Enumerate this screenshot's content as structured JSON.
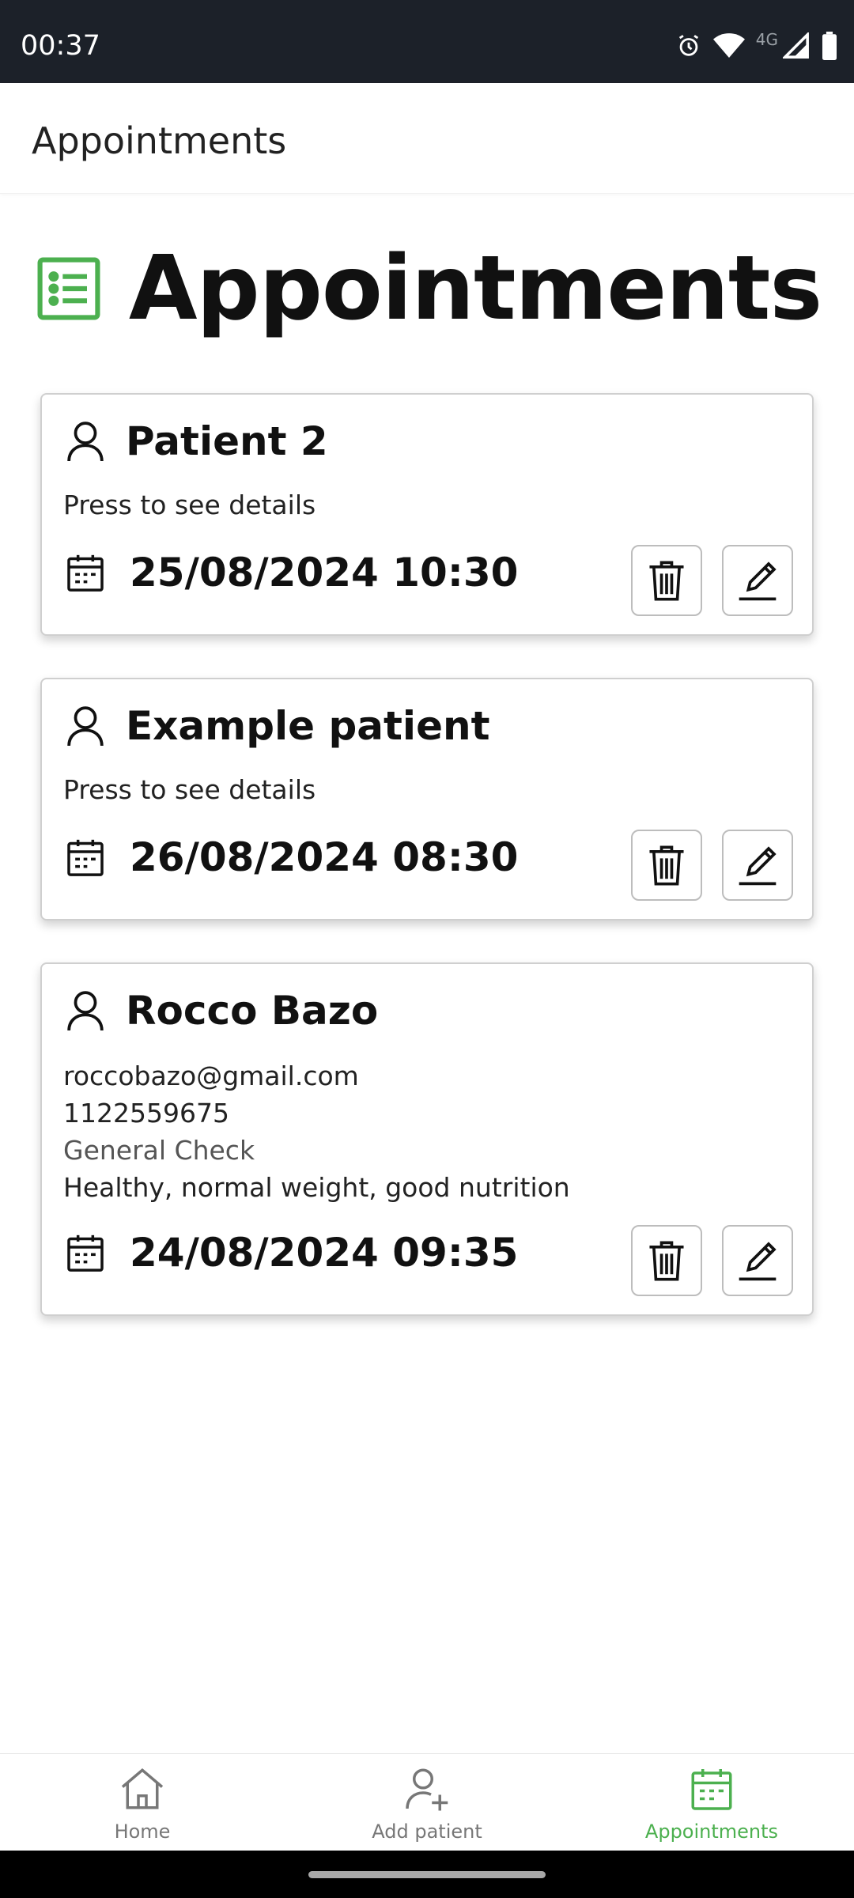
{
  "status_bar": {
    "time": "00:37",
    "network_label": "4G"
  },
  "app_bar": {
    "title": "Appointments"
  },
  "page": {
    "title": "Appointments",
    "accent_color": "#4cb04f"
  },
  "appointments": [
    {
      "name": "Patient 2",
      "lines": [
        "Press to see details"
      ],
      "datetime": "25/08/2024 10:30"
    },
    {
      "name": "Example patient",
      "lines": [
        "Press to see details"
      ],
      "datetime": "26/08/2024 08:30"
    },
    {
      "name": "Rocco Bazo",
      "lines": [
        "roccobazo@gmail.com",
        "1122559675",
        "General Check",
        "Healthy, normal weight, good nutrition"
      ],
      "datetime": "24/08/2024 09:35"
    }
  ],
  "bottom_nav": {
    "items": [
      {
        "label": "Home",
        "icon": "home-icon",
        "active": false
      },
      {
        "label": "Add patient",
        "icon": "add-person-icon",
        "active": false
      },
      {
        "label": "Appointments",
        "icon": "calendar-icon",
        "active": true
      }
    ]
  }
}
